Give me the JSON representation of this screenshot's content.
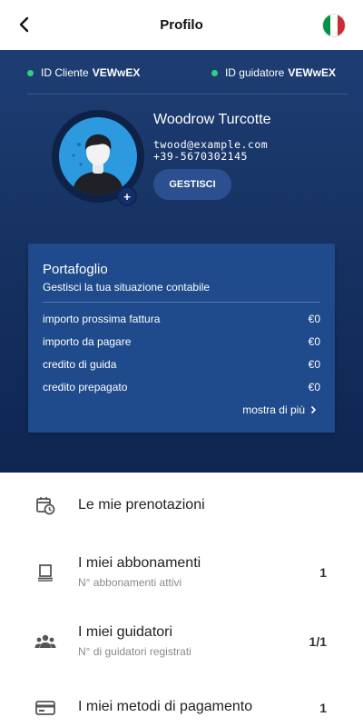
{
  "header": {
    "title": "Profilo",
    "back_icon": "back-arrow-icon",
    "flag_icon": "italy-flag-icon",
    "flag_colors": [
      "#009246",
      "#ffffff",
      "#ce2b37"
    ]
  },
  "profile": {
    "client_id_label": "ID Cliente",
    "client_id_value": "VEWwEX",
    "driver_id_label": "ID guidatore",
    "driver_id_value": "VEWwEX",
    "name": "Woodrow Turcotte",
    "email": "twood@example.com",
    "phone": "+39-5670302145",
    "manage_button": "GESTISCI",
    "avatar_plus": "+",
    "status_color": "#2fd17a"
  },
  "wallet": {
    "title": "Portafoglio",
    "subtitle": "Gestisci la tua situazione contabile",
    "rows": [
      {
        "label": "importo prossima fattura",
        "value": "€0"
      },
      {
        "label": "importo da pagare",
        "value": "€0"
      },
      {
        "label": "credito di guida",
        "value": "€0"
      },
      {
        "label": "credito prepagato",
        "value": "€0"
      }
    ],
    "more_label": "mostra di più",
    "more_icon": "chevron-right-icon"
  },
  "menu": {
    "items": [
      {
        "title": "Le mie prenotazioni",
        "subtitle": "",
        "count": "",
        "icon": "calendar-clock-icon"
      },
      {
        "title": "I miei abbonamenti",
        "subtitle": "N° abbonamenti attivi",
        "count": "1",
        "icon": "subscription-icon"
      },
      {
        "title": "I miei guidatori",
        "subtitle": "N° di guidatori registrati",
        "count": "1/1",
        "icon": "people-icon"
      },
      {
        "title": "I miei metodi di pagamento",
        "subtitle": "",
        "count": "1",
        "icon": "credit-card-icon"
      }
    ]
  }
}
